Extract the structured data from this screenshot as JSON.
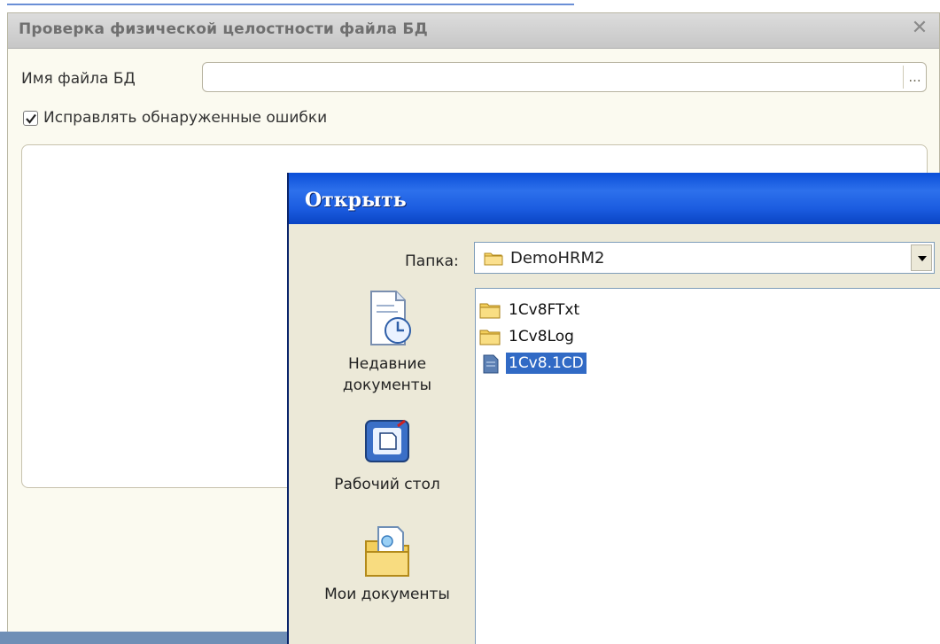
{
  "main_window": {
    "title": "Проверка физической целостности файла БД",
    "close_glyph": "✕",
    "db_file": {
      "label": "Имя файла БД",
      "value": "",
      "browse_glyph": "..."
    },
    "fix_errors": {
      "label": "Исправлять обнаруженные ошибки",
      "checked": true
    }
  },
  "open_dialog": {
    "title": "Открыть",
    "folder": {
      "label": "Папка:",
      "value": "DemoHRM2"
    },
    "places": [
      {
        "label1": "Недавние",
        "label2": "документы",
        "icon": "recent-documents-icon"
      },
      {
        "label1": "Рабочий стол",
        "label2": "",
        "icon": "desktop-icon"
      },
      {
        "label1": "Мои документы",
        "label2": "",
        "icon": "my-documents-icon"
      }
    ],
    "files": [
      {
        "name": "1Cv8FTxt",
        "type": "folder",
        "selected": false
      },
      {
        "name": "1Cv8Log",
        "type": "folder",
        "selected": false
      },
      {
        "name": "1Cv8.1CD",
        "type": "file",
        "selected": true
      }
    ]
  },
  "colors": {
    "dialog_title": "#1b5ce0",
    "selection": "#316ac5",
    "dialog_bg": "#ece9d8",
    "main_bg": "#fbfaf0"
  }
}
